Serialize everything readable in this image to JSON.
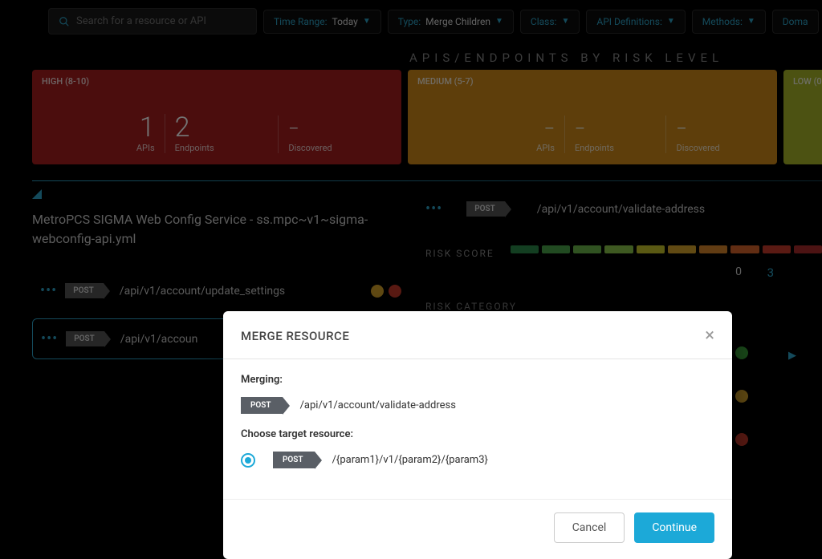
{
  "search": {
    "placeholder": "Search for a resource or API"
  },
  "filters": {
    "time_range": {
      "label": "Time Range:",
      "value": "Today"
    },
    "type": {
      "label": "Type:",
      "value": "Merge Children"
    },
    "class": {
      "label": "Class:",
      "value": ""
    },
    "api_defs": {
      "label": "API Definitions:",
      "value": ""
    },
    "methods": {
      "label": "Methods:",
      "value": ""
    },
    "doma": {
      "label": "Doma",
      "value": ""
    }
  },
  "risk_section_title": "APIS/ENDPOINTS BY RISK LEVEL",
  "risk_cards": {
    "high": {
      "header": "HIGH (8-10)",
      "apis": "1",
      "apis_label": "APIs",
      "endpoints": "2",
      "endpoints_label": "Endpoints",
      "discovered": "–",
      "discovered_label": "Discovered"
    },
    "medium": {
      "header": "MEDIUM (5-7)",
      "apis": "–",
      "apis_label": "APIs",
      "endpoints": "–",
      "endpoints_label": "Endpoints",
      "discovered": "–",
      "discovered_label": "Discovered"
    },
    "low": {
      "header": "LOW (0"
    }
  },
  "left": {
    "service_name": "MetroPCS SIGMA Web Config Service - ss.mpc~v1~sigma-webconfig-api.yml",
    "row1": {
      "method": "POST",
      "path": "/api/v1/account/update_settings"
    },
    "row2": {
      "method": "POST",
      "path": "/api/v1/accoun"
    }
  },
  "right": {
    "top": {
      "method": "POST",
      "path": "/api/v1/account/validate-address"
    },
    "risk_score_label": "RISK SCORE",
    "risk_category_label": "RISK CATEGORY",
    "score_value_0": "0",
    "score_value_3": "3"
  },
  "modal": {
    "title": "MERGE RESOURCE",
    "merging_label": "Merging:",
    "merging_method": "POST",
    "merging_path": "/api/v1/account/validate-address",
    "choose_label": "Choose target resource:",
    "target_method": "POST",
    "target_path": "/{param1}/v1/{param2}/{param3}",
    "cancel": "Cancel",
    "continue": "Continue"
  },
  "colors": {
    "score_segs": [
      "#2a8a4a",
      "#4aa54a",
      "#6ab54a",
      "#8ac54a",
      "#c8c52a",
      "#d8a52a",
      "#d8852a",
      "#d8652a",
      "#c83a2a",
      "#a82a2a"
    ],
    "status_green": "#3aa53a",
    "status_yellow": "#d8a52a",
    "status_red": "#c83a2a",
    "status_orange": "#d8852a"
  }
}
